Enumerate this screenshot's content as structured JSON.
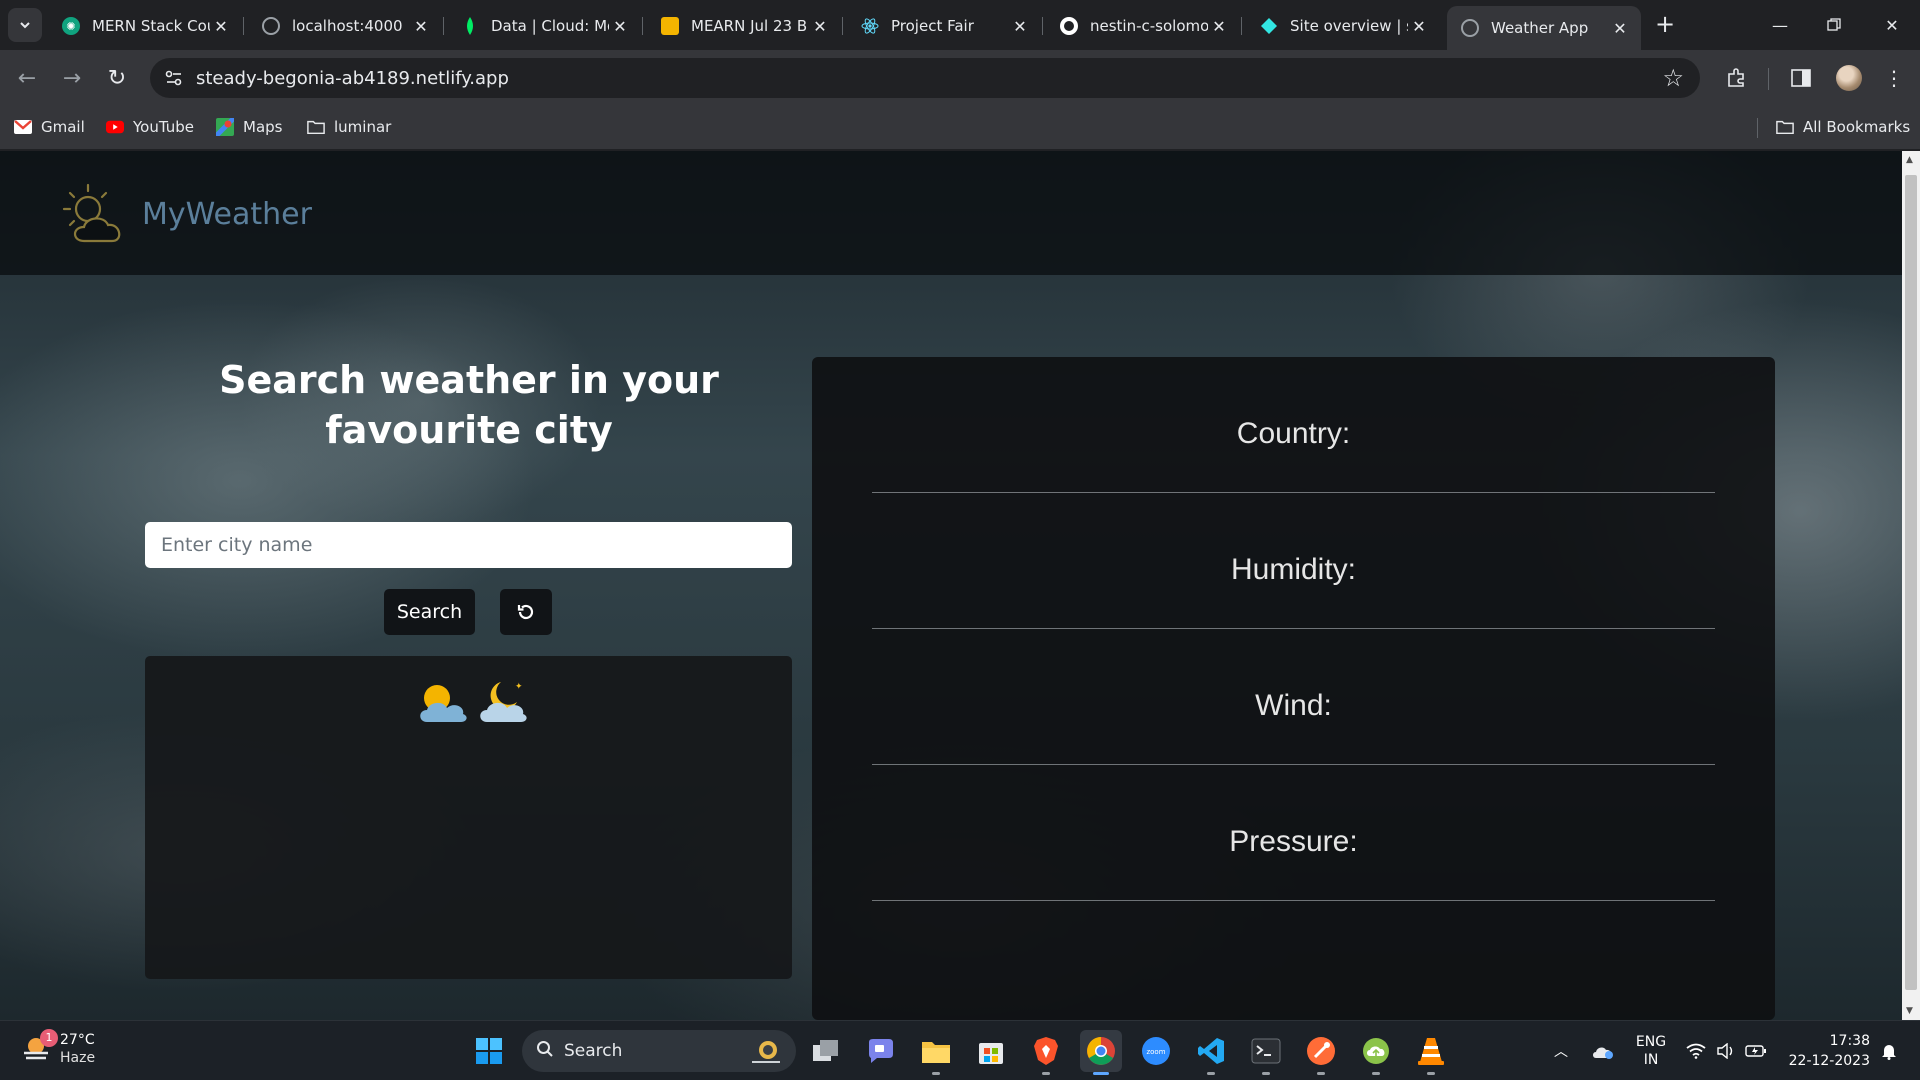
{
  "browser": {
    "tabs": [
      {
        "title": "MERN Stack Cou",
        "favicon": "chatgpt-icon",
        "color": "#10a37f"
      },
      {
        "title": "localhost:4000",
        "favicon": "globe-icon",
        "color": "#9aa0a6"
      },
      {
        "title": "Data | Cloud: Mo",
        "favicon": "mongodb-leaf-icon",
        "color": "#00ed64"
      },
      {
        "title": "MEARN Jul 23 B",
        "favicon": "google-slides-icon",
        "color": "#f4b400"
      },
      {
        "title": "Project Fair",
        "favicon": "react-icon",
        "color": "#61dafb"
      },
      {
        "title": "nestin-c-solomo",
        "favicon": "github-icon",
        "color": "#ffffff"
      },
      {
        "title": "Site overview | st",
        "favicon": "netlify-icon",
        "color": "#32e6e2"
      },
      {
        "title": "Weather App",
        "favicon": "globe-icon",
        "color": "#9aa0a6",
        "active": true
      }
    ],
    "url": "steady-begonia-ab4189.netlify.app",
    "bookmarks": [
      {
        "label": "Gmail",
        "icon": "gmail-icon"
      },
      {
        "label": "YouTube",
        "icon": "youtube-icon"
      },
      {
        "label": "Maps",
        "icon": "maps-icon"
      },
      {
        "label": "luminar",
        "icon": "folder-icon"
      }
    ],
    "all_bookmarks": "All Bookmarks"
  },
  "app": {
    "brand": "MyWeather",
    "search_title": "Search weather in your favourite city",
    "city_input": {
      "placeholder": "Enter city name",
      "value": ""
    },
    "search_button": "Search",
    "reset_button_icon": "refresh-icon",
    "weather_icons": [
      "sun-behind-cloud-icon",
      "moon-behind-cloud-icon"
    ],
    "details": [
      {
        "label": "Country:"
      },
      {
        "label": "Humidity:"
      },
      {
        "label": "Wind:"
      },
      {
        "label": "Pressure:"
      }
    ],
    "colors": {
      "brand": "#5b7f9b",
      "button": "#111417",
      "card": "#0e1012"
    }
  },
  "taskbar": {
    "weather": {
      "temp": "27°C",
      "condition": "Haze",
      "badge": "1"
    },
    "search_label": "Search",
    "language": {
      "lang": "ENG",
      "region": "IN"
    },
    "time": "17:38",
    "date": "22-12-2023"
  }
}
